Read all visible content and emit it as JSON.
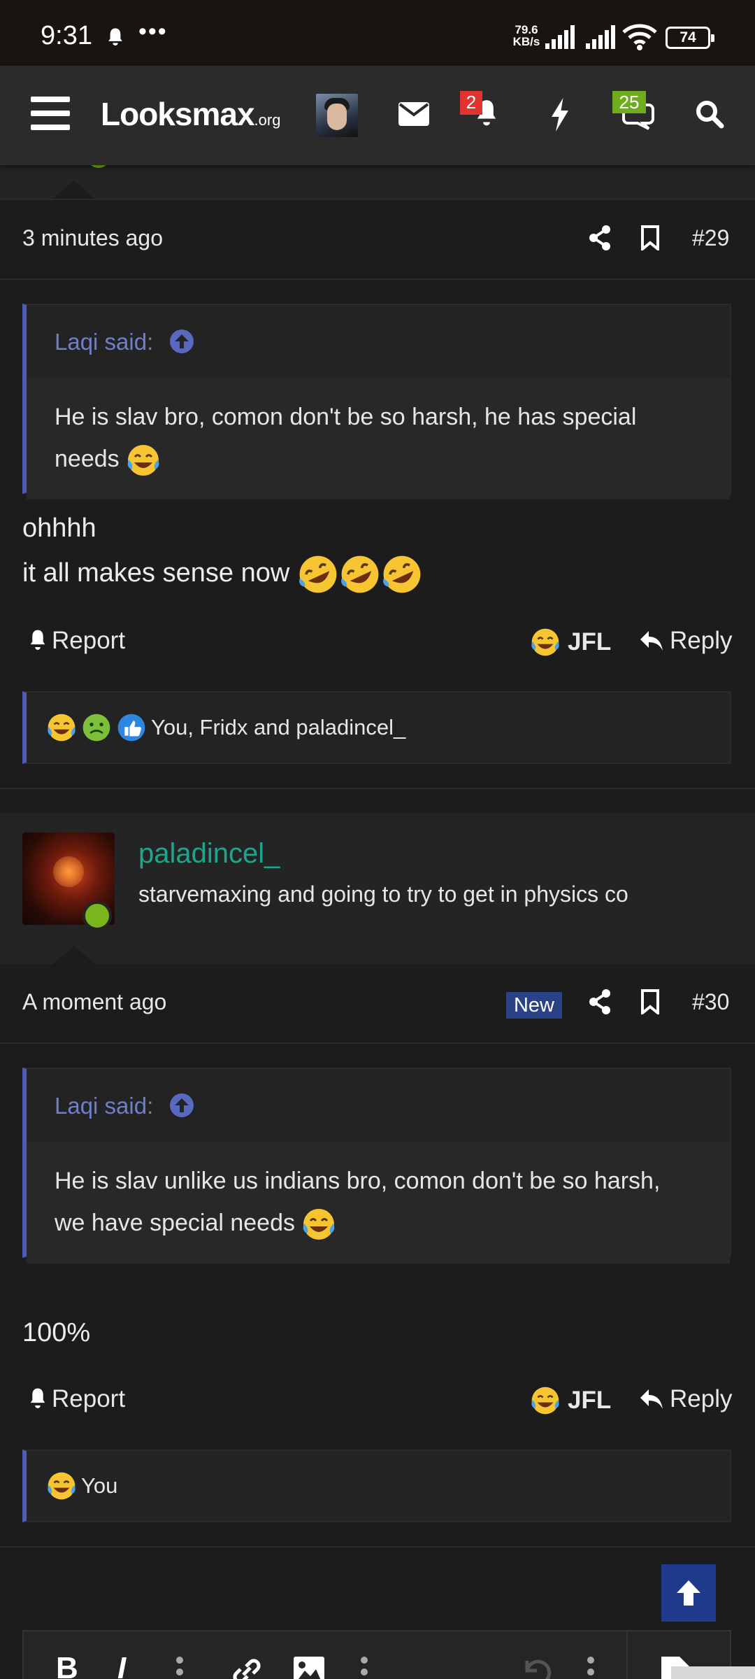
{
  "status_bar": {
    "time": "9:31",
    "dots": "•••",
    "net_speed_value": "79.6",
    "net_speed_unit": "KB/s",
    "battery": "74"
  },
  "header": {
    "logo_main": "Looksmax",
    "logo_suffix": ".org",
    "notifications_count": "2",
    "conversations_count": "25"
  },
  "post29": {
    "time": "3 minutes ago",
    "number": "#29",
    "quote_author": "Laqi said:",
    "quote_text": "He is slav bro, comon don't be so harsh, he has special needs",
    "body_line1": "ohhhh",
    "body_line2": "it all makes sense now",
    "report": "Report",
    "jfl": "JFL",
    "reply": "Reply",
    "reactions_text": "You, Fridx and paladincel_"
  },
  "post30": {
    "username": "paladincel_",
    "user_title": "starvemaxing and going to try to get in physics co",
    "time": "A moment ago",
    "new_badge": "New",
    "number": "#30",
    "quote_author": "Laqi said:",
    "quote_line1": "He is slav unlike us indians bro, comon don't be so harsh,",
    "quote_line2": "we have special needs",
    "body": "100%",
    "report": "Report",
    "jfl": "JFL",
    "reply": "Reply",
    "reactions_text": "You"
  },
  "editor": {
    "bold": "B",
    "italic": "I"
  },
  "colors": {
    "background": "#1c1c1c",
    "header": "#2b2b2b",
    "quote_accent": "#4f5bb5",
    "username": "#1fa58e",
    "new_badge": "#2a4286",
    "online": "#79b51c"
  }
}
